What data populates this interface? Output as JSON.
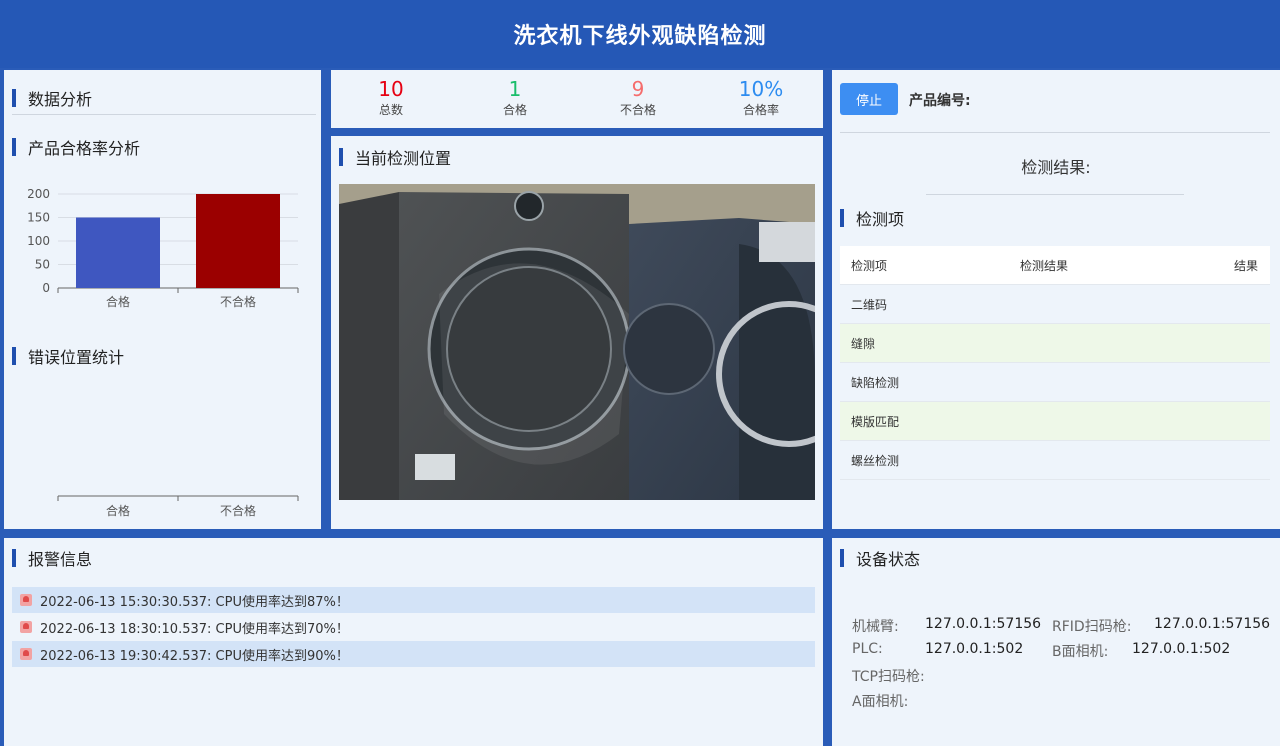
{
  "header": {
    "title": "洗衣机下线外观缺陷检测"
  },
  "analysis": {
    "title": "数据分析",
    "pass_rate_title": "产品合格率分析",
    "error_title": "错误位置统计"
  },
  "chart_data": [
    {
      "type": "bar",
      "title": "产品合格率分析",
      "categories": [
        "合格",
        "不合格"
      ],
      "values": [
        150,
        200
      ],
      "colors": [
        "#3f57c0",
        "#9b0000"
      ],
      "ylim": [
        0,
        200
      ],
      "yticks": [
        0,
        50,
        100,
        150,
        200
      ],
      "grid": true
    },
    {
      "type": "bar",
      "title": "错误位置统计",
      "categories": [
        "合格",
        "不合格"
      ],
      "values": [],
      "grid": false
    }
  ],
  "stats": [
    {
      "value": "10",
      "label": "总数",
      "color": "#e60012"
    },
    {
      "value": "1",
      "label": "合格",
      "color": "#19be6b"
    },
    {
      "value": "9",
      "label": "不合格",
      "color": "#f56c6c"
    },
    {
      "value": "10%",
      "label": "合格率",
      "color": "#2d8cf0"
    }
  ],
  "position": {
    "title": "当前检测位置"
  },
  "control": {
    "stop_label": "停止",
    "product_no_label": "产品编号:",
    "result_label": "检测结果:"
  },
  "inspection": {
    "title": "检测项",
    "headers": [
      "检测项",
      "检测结果",
      "结果"
    ],
    "rows": [
      "二维码",
      "缝隙",
      "缺陷检测",
      "模版匹配",
      "螺丝检测"
    ]
  },
  "alarms": {
    "title": "报警信息",
    "items": [
      "2022-06-13 15:30:30.537: CPU使用率达到87%！",
      "2022-06-13 18:30:10.537: CPU使用率达到70%！",
      "2022-06-13 19:30:42.537: CPU使用率达到90%！"
    ]
  },
  "device": {
    "title": "设备状态",
    "arm_label": "机械臂:",
    "arm_value": "127.0.0.1:57156",
    "rfid_label": "RFID扫码枪:",
    "rfid_value": "127.0.0.1:57156",
    "plc_label": "PLC:",
    "plc_value": "127.0.0.1:502",
    "bcam_label": "B面相机:",
    "bcam_value": "127.0.0.1:502",
    "tcp_label": "TCP扫码枪:",
    "acam_label": "A面相机:"
  }
}
